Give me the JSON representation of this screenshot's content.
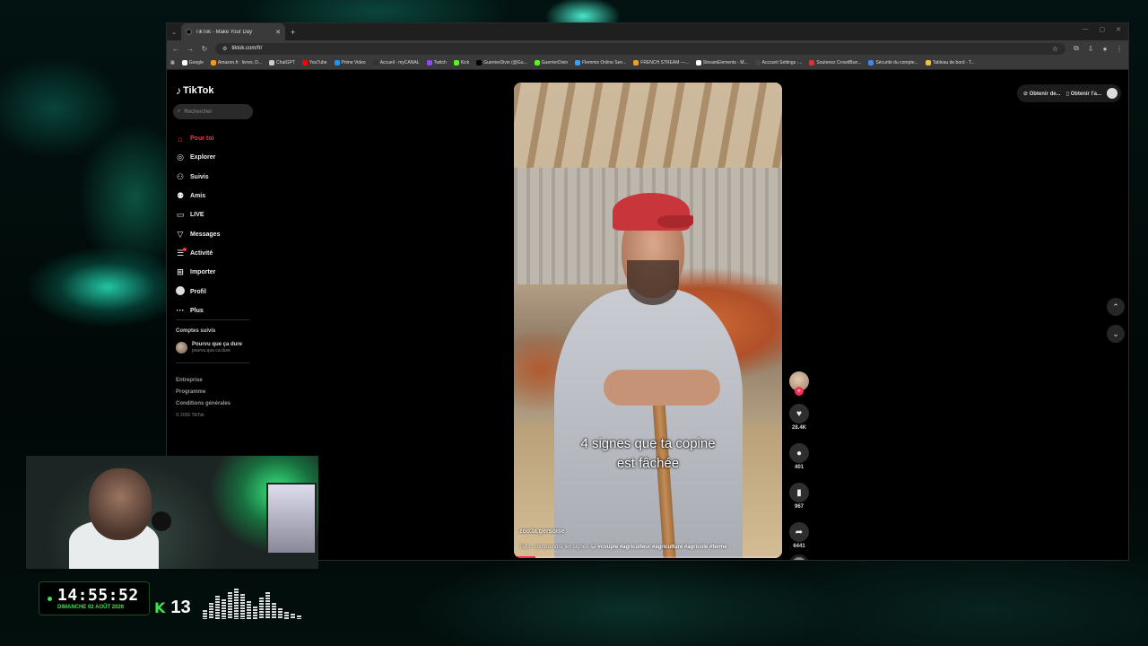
{
  "browser": {
    "tab_title": "TikTok - Make Your Day",
    "url": "tiktok.com/fr/",
    "bookmarks": [
      {
        "label": "Google",
        "color": "#ffffff"
      },
      {
        "label": "Amazon.fr : livres, D...",
        "color": "#ff9900"
      },
      {
        "label": "ChatGPT",
        "color": "#cccccc"
      },
      {
        "label": "YouTube",
        "color": "#ff0000"
      },
      {
        "label": "Prime Video",
        "color": "#1a98ff"
      },
      {
        "label": "Accueil - myCANAL",
        "color": "#333333"
      },
      {
        "label": "Twitch",
        "color": "#9146ff"
      },
      {
        "label": "Kick",
        "color": "#53fc18"
      },
      {
        "label": "GuerrierDivin (@Gu...",
        "color": "#000000"
      },
      {
        "label": "GuerrierDivin",
        "color": "#53fc18"
      },
      {
        "label": "Flemmix Online Sen...",
        "color": "#3aa0ff"
      },
      {
        "label": "FRENCH STREAM —...",
        "color": "#f0a020"
      },
      {
        "label": "StreamElements - M...",
        "color": "#ffffff"
      },
      {
        "label": "Account Settings -...",
        "color": "#444444"
      },
      {
        "label": "Soutenez CrowdBun...",
        "color": "#e03030"
      },
      {
        "label": "Sécurité du compte...",
        "color": "#4285f4"
      },
      {
        "label": "Tableau de bord - T...",
        "color": "#f0c040"
      }
    ]
  },
  "sidebar": {
    "logo": "TikTok",
    "search_placeholder": "Rechercher",
    "nav": [
      {
        "label": "Pour toi",
        "icon": "home-icon",
        "glyph": "⌂"
      },
      {
        "label": "Explorer",
        "icon": "compass-icon",
        "glyph": "◎"
      },
      {
        "label": "Suivis",
        "icon": "following-icon",
        "glyph": "⚇"
      },
      {
        "label": "Amis",
        "icon": "friends-icon",
        "glyph": "⚉"
      },
      {
        "label": "LIVE",
        "icon": "live-icon",
        "glyph": "▭"
      },
      {
        "label": "Messages",
        "icon": "messages-icon",
        "glyph": "▽"
      },
      {
        "label": "Activité",
        "icon": "activity-icon",
        "glyph": "☰"
      },
      {
        "label": "Importer",
        "icon": "upload-icon",
        "glyph": "⊞"
      },
      {
        "label": "Profil",
        "icon": "profile-icon",
        "glyph": ""
      },
      {
        "label": "Plus",
        "icon": "more-icon",
        "glyph": "···"
      }
    ],
    "followed_title": "Comptes suivis",
    "followed": [
      {
        "name": "Pourvu que ça dure",
        "handle": "pourvu.que.ca.dure"
      }
    ],
    "footer": [
      "Entreprise",
      "Programme",
      "Conditions générales"
    ],
    "copyright": "© 2026 TikTok"
  },
  "video": {
    "caption_line1": "4 signes que ta copine",
    "caption_line2": "est fâchée",
    "author": "zoo.la.gersoise",
    "description": "Tuto : comprendre les signes 😂 ",
    "tags": "#couple #agriculteur #agriculture #agricole #ferme",
    "progress": 0.08
  },
  "actions": {
    "likes": "28.4K",
    "comments": "401",
    "saves": "967",
    "shares": "6441"
  },
  "topright": {
    "btn1": "Obtenir de...",
    "btn2": "Obtenir l'a..."
  },
  "overlay": {
    "time": "14:55:52",
    "date": "DIMANCHE 02 AOÛT 2026",
    "kick_letter": "K",
    "viewers": "13"
  }
}
